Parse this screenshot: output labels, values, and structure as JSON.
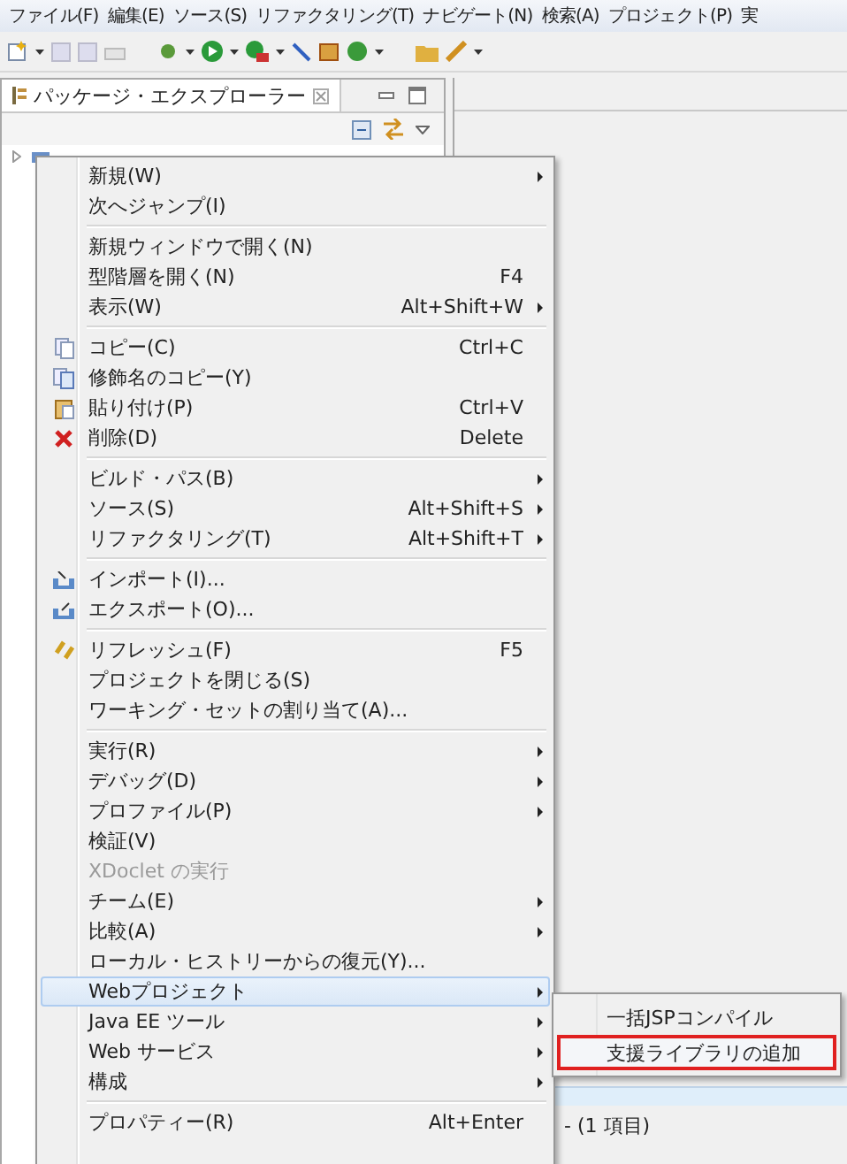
{
  "menubar": [
    {
      "label": "ファイル(F)"
    },
    {
      "label": "編集(E)"
    },
    {
      "label": "ソース(S)"
    },
    {
      "label": "リファクタリング(T)"
    },
    {
      "label": "ナビゲート(N)"
    },
    {
      "label": "検索(A)"
    },
    {
      "label": "プロジェクト(P)"
    },
    {
      "label": "実"
    }
  ],
  "explorer": {
    "title": "パッケージ・エクスプローラー"
  },
  "context_menu": {
    "items": [
      {
        "kind": "item",
        "label": "新規(W)",
        "submenu": true,
        "disabled": false,
        "selected": false
      },
      {
        "kind": "item",
        "label": "次へジャンプ(I)",
        "submenu": false,
        "disabled": false,
        "selected": false
      },
      {
        "kind": "separator"
      },
      {
        "kind": "item",
        "label": "新規ウィンドウで開く(N)",
        "submenu": false,
        "disabled": false,
        "selected": false
      },
      {
        "kind": "item",
        "label": "型階層を開く(N)",
        "shortcut": "F4",
        "submenu": false,
        "disabled": false,
        "selected": false
      },
      {
        "kind": "item",
        "label": "表示(W)",
        "shortcut": "Alt+Shift+W",
        "submenu": true,
        "disabled": false,
        "selected": false
      },
      {
        "kind": "separator"
      },
      {
        "kind": "item",
        "label": "コピー(C)",
        "shortcut": "Ctrl+C",
        "submenu": false,
        "disabled": false,
        "selected": false
      },
      {
        "kind": "item",
        "label": "修飾名のコピー(Y)",
        "submenu": false,
        "disabled": false,
        "selected": false
      },
      {
        "kind": "item",
        "label": "貼り付け(P)",
        "shortcut": "Ctrl+V",
        "submenu": false,
        "disabled": false,
        "selected": false
      },
      {
        "kind": "item",
        "label": "削除(D)",
        "shortcut": "Delete",
        "submenu": false,
        "disabled": false,
        "selected": false
      },
      {
        "kind": "separator"
      },
      {
        "kind": "item",
        "label": "ビルド・パス(B)",
        "submenu": true,
        "disabled": false,
        "selected": false
      },
      {
        "kind": "item",
        "label": "ソース(S)",
        "shortcut": "Alt+Shift+S",
        "submenu": true,
        "disabled": false,
        "selected": false
      },
      {
        "kind": "item",
        "label": "リファクタリング(T)",
        "shortcut": "Alt+Shift+T",
        "submenu": true,
        "disabled": false,
        "selected": false
      },
      {
        "kind": "separator"
      },
      {
        "kind": "item",
        "label": "インポート(I)...",
        "submenu": false,
        "disabled": false,
        "selected": false
      },
      {
        "kind": "item",
        "label": "エクスポート(O)...",
        "submenu": false,
        "disabled": false,
        "selected": false
      },
      {
        "kind": "separator"
      },
      {
        "kind": "item",
        "label": "リフレッシュ(F)",
        "shortcut": "F5",
        "submenu": false,
        "disabled": false,
        "selected": false
      },
      {
        "kind": "item",
        "label": "プロジェクトを閉じる(S)",
        "submenu": false,
        "disabled": false,
        "selected": false
      },
      {
        "kind": "item",
        "label": "ワーキング・セットの割り当て(A)...",
        "submenu": false,
        "disabled": false,
        "selected": false
      },
      {
        "kind": "separator"
      },
      {
        "kind": "item",
        "label": "実行(R)",
        "submenu": true,
        "disabled": false,
        "selected": false
      },
      {
        "kind": "item",
        "label": "デバッグ(D)",
        "submenu": true,
        "disabled": false,
        "selected": false
      },
      {
        "kind": "item",
        "label": "プロファイル(P)",
        "submenu": true,
        "disabled": false,
        "selected": false
      },
      {
        "kind": "item",
        "label": "検証(V)",
        "submenu": false,
        "disabled": false,
        "selected": false
      },
      {
        "kind": "item",
        "label": "XDoclet の実行",
        "submenu": false,
        "disabled": true,
        "selected": false
      },
      {
        "kind": "item",
        "label": "チーム(E)",
        "submenu": true,
        "disabled": false,
        "selected": false
      },
      {
        "kind": "item",
        "label": "比較(A)",
        "submenu": true,
        "disabled": false,
        "selected": false
      },
      {
        "kind": "item",
        "label": "ローカル・ヒストリーからの復元(Y)...",
        "submenu": false,
        "disabled": false,
        "selected": false
      },
      {
        "kind": "item",
        "label": "Webプロジェクト",
        "submenu": true,
        "disabled": false,
        "selected": true
      },
      {
        "kind": "item",
        "label": "Java EE ツール",
        "submenu": true,
        "disabled": false,
        "selected": false
      },
      {
        "kind": "item",
        "label": "Web サービス",
        "submenu": true,
        "disabled": false,
        "selected": false
      },
      {
        "kind": "item",
        "label": "構成",
        "submenu": true,
        "disabled": false,
        "selected": false
      },
      {
        "kind": "separator"
      },
      {
        "kind": "item",
        "label": "プロパティー(R)",
        "shortcut": "Alt+Enter",
        "submenu": false,
        "disabled": false,
        "selected": false
      }
    ]
  },
  "submenu": {
    "items": [
      {
        "label": "一括JSPコンパイル",
        "outlined": false
      },
      {
        "label": "支援ライブラリの追加",
        "outlined": true
      }
    ]
  },
  "lower_view": {
    "text": "- (1 項目)"
  }
}
